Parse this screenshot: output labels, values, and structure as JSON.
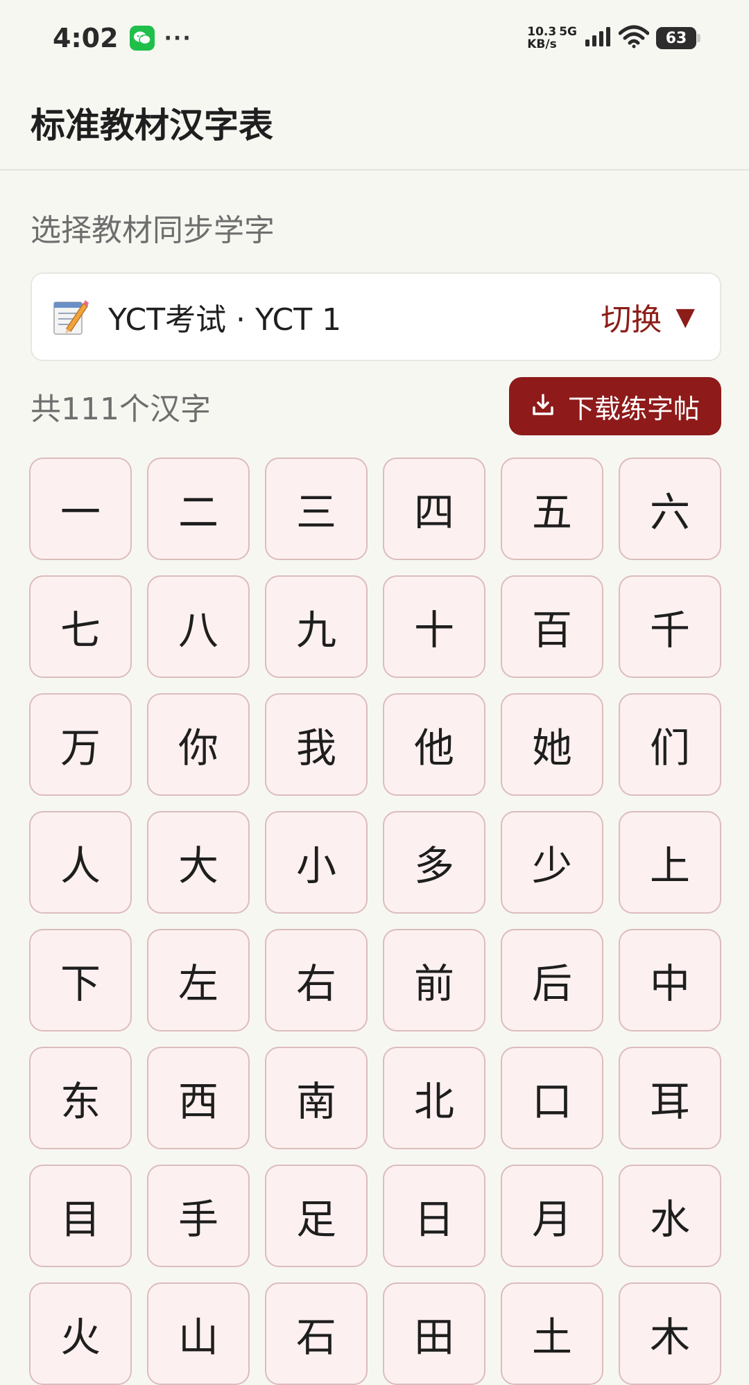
{
  "status_bar": {
    "time": "4:02",
    "net_speed_value": "10.3",
    "net_speed_unit": "KB/s",
    "network": "5G",
    "battery": "63",
    "more": "···"
  },
  "header": {
    "title": "标准教材汉字表"
  },
  "subtitle": "选择教材同步学字",
  "selector": {
    "text": "YCT考试 · YCT 1",
    "switch_label": "切换",
    "switch_arrow": "▼"
  },
  "count_text": "共111个汉字",
  "download_button": {
    "label": "下载练字帖"
  },
  "characters": [
    "一",
    "二",
    "三",
    "四",
    "五",
    "六",
    "七",
    "八",
    "九",
    "十",
    "百",
    "千",
    "万",
    "你",
    "我",
    "他",
    "她",
    "们",
    "人",
    "大",
    "小",
    "多",
    "少",
    "上",
    "下",
    "左",
    "右",
    "前",
    "后",
    "中",
    "东",
    "西",
    "南",
    "北",
    "口",
    "耳",
    "目",
    "手",
    "足",
    "日",
    "月",
    "水",
    "火",
    "山",
    "石",
    "田",
    "土",
    "木"
  ],
  "colors": {
    "accent": "#8e1a1a",
    "cell_bg": "#fdf0f0",
    "cell_border": "#dcbcbc",
    "page_bg": "#f7f7f2"
  }
}
